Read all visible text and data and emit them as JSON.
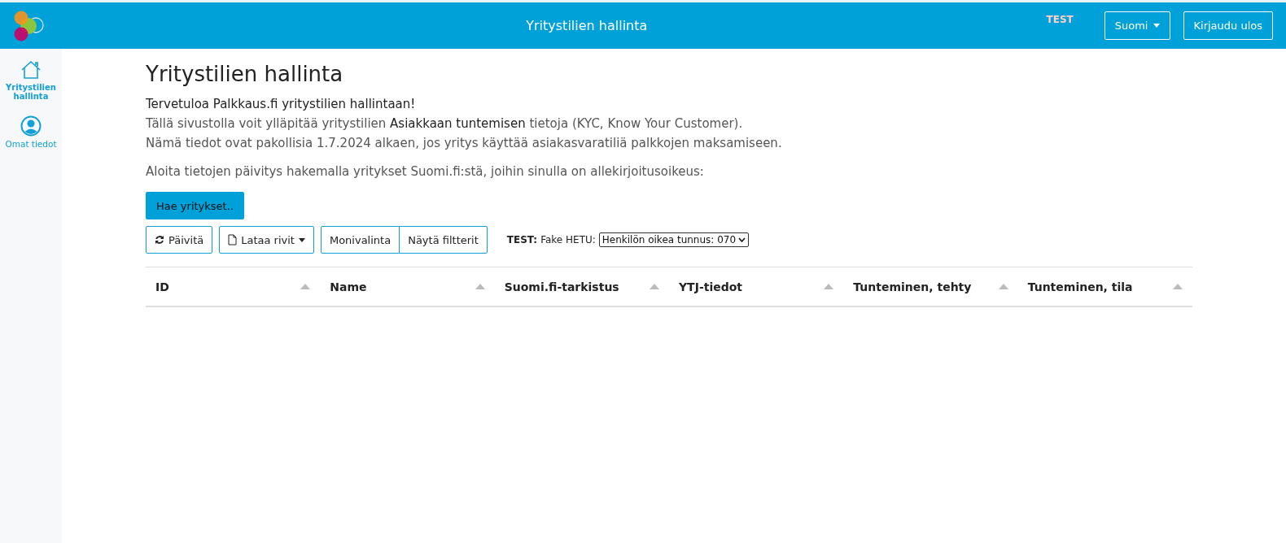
{
  "header": {
    "title": "Yritystilien hallinta",
    "env_label": "TEST",
    "language": "Suomi",
    "logout": "Kirjaudu ulos"
  },
  "sidebar": {
    "items": [
      {
        "label": "Yritystilien hallinta",
        "kind": "home",
        "selected": true
      },
      {
        "label": "Omat tiedot",
        "kind": "user",
        "selected": false
      }
    ]
  },
  "page": {
    "title": "Yritystilien hallinta",
    "welcome": "Tervetuloa Palkkaus.fi yritystilien hallintaan!",
    "lines": [
      "Tällä sivustolla voit ylläpitää yritystilien **Asiakkaan tuntemisen** tietoja (KYC, Know Your Customer).",
      "Nämä tiedot ovat pakollisia 1.7.2024 alkaen, jos yritys käyttää asiakasvaratiliä palkkojen maksamiseen."
    ],
    "prompt": "Aloita tietojen päivitys hakemalla yritykset Suomi.fi:stä, joihin sinulla on allekirjoitusoikeus:",
    "fetch_button": "Hae yritykset.."
  },
  "toolbar": {
    "refresh": "Päivitä",
    "download": "Lataa rivit",
    "multiselect": "Monivalinta",
    "filters": "Näytä filtterit",
    "test_label": "TEST:",
    "hetu_label": "Fake HETU:",
    "hetu_value": "Henkilön oikea tunnus: 070"
  },
  "table": {
    "columns": [
      "ID",
      "Name",
      "Suomi.fi-tarkistus",
      "YTJ-tiedot",
      "Tunteminen, tehty",
      "Tunteminen, tila"
    ]
  }
}
